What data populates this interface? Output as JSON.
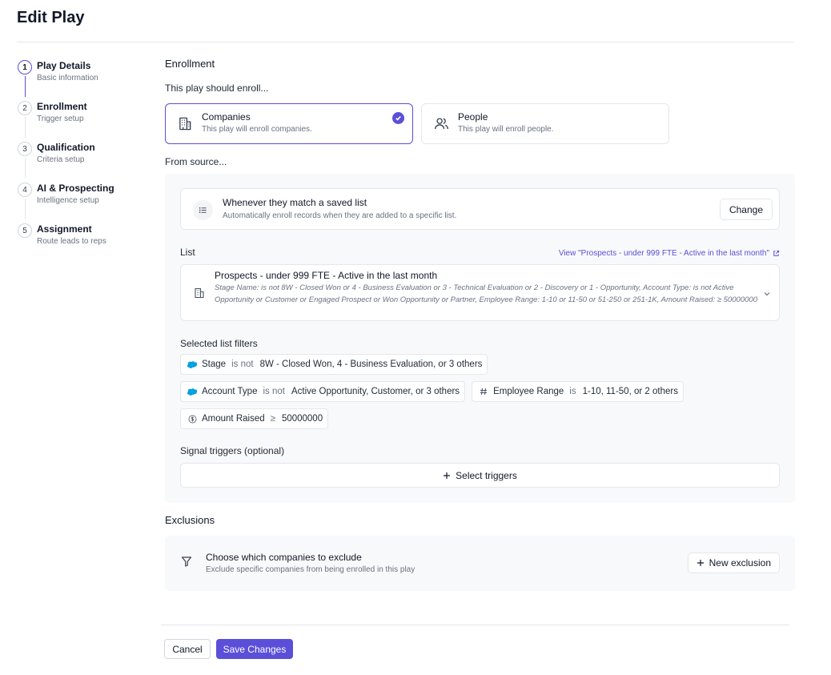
{
  "page": {
    "title": "Edit Play"
  },
  "steps": [
    {
      "number": "1",
      "title": "Play Details",
      "subtitle": "Basic information"
    },
    {
      "number": "2",
      "title": "Enrollment",
      "subtitle": "Trigger setup"
    },
    {
      "number": "3",
      "title": "Qualification",
      "subtitle": "Criteria setup"
    },
    {
      "number": "4",
      "title": "AI & Prospecting",
      "subtitle": "Intelligence setup"
    },
    {
      "number": "5",
      "title": "Assignment",
      "subtitle": "Route leads to reps"
    }
  ],
  "enrollment": {
    "title": "Enrollment",
    "prompt": "This play should enroll...",
    "options": [
      {
        "title": "Companies",
        "description": "This play will enroll companies.",
        "icon": "building-icon",
        "selected": true
      },
      {
        "title": "People",
        "description": "This play will enroll people.",
        "icon": "people-icon",
        "selected": false
      }
    ],
    "accent_color": "#5b4fd9"
  },
  "source": {
    "label": "From source...",
    "title": "Whenever they match a saved list",
    "description": "Automatically enroll records when they are added to a specific list.",
    "change_label": "Change"
  },
  "list": {
    "label": "List",
    "view_link": "View \"Prospects - under 999 FTE - Active in the last month\"",
    "name": "Prospects - under 999 FTE - Active in the last month",
    "description": "Stage Name: is not 8W - Closed Won or 4 - Business Evaluation or 3 - Technical Evaluation or 2 - Discovery or 1 - Opportunity, Account Type: is not Active Opportunity or Customer or Engaged Prospect or Won Opportunity or Partner, Employee Range: 1-10 or 11-50 or 51-250 or 251-1K, Amount Raised: ≥ 50000000"
  },
  "filters": {
    "label": "Selected list filters",
    "items": [
      {
        "field": "Stage",
        "operator": "is not",
        "value": "8W - Closed Won, 4 - Business Evaluation, or 3 others",
        "icon": "salesforce-icon"
      },
      {
        "field": "Account Type",
        "operator": "is not",
        "value": "Active Opportunity, Customer, or 3 others",
        "icon": "salesforce-icon"
      },
      {
        "field": "Employee Range",
        "operator": "is",
        "value": "1-10, 11-50, or 2 others",
        "icon": "hash-icon"
      },
      {
        "field": "Amount Raised",
        "operator": "≥",
        "value": "50000000",
        "icon": "dollar-icon"
      }
    ]
  },
  "signals": {
    "label": "Signal triggers (optional)",
    "button_label": "Select triggers"
  },
  "exclusions": {
    "title": "Exclusions",
    "heading": "Choose which companies to exclude",
    "description": "Exclude specific companies from being enrolled in this play",
    "button_label": "New exclusion"
  },
  "footer": {
    "cancel_label": "Cancel",
    "save_label": "Save Changes"
  }
}
